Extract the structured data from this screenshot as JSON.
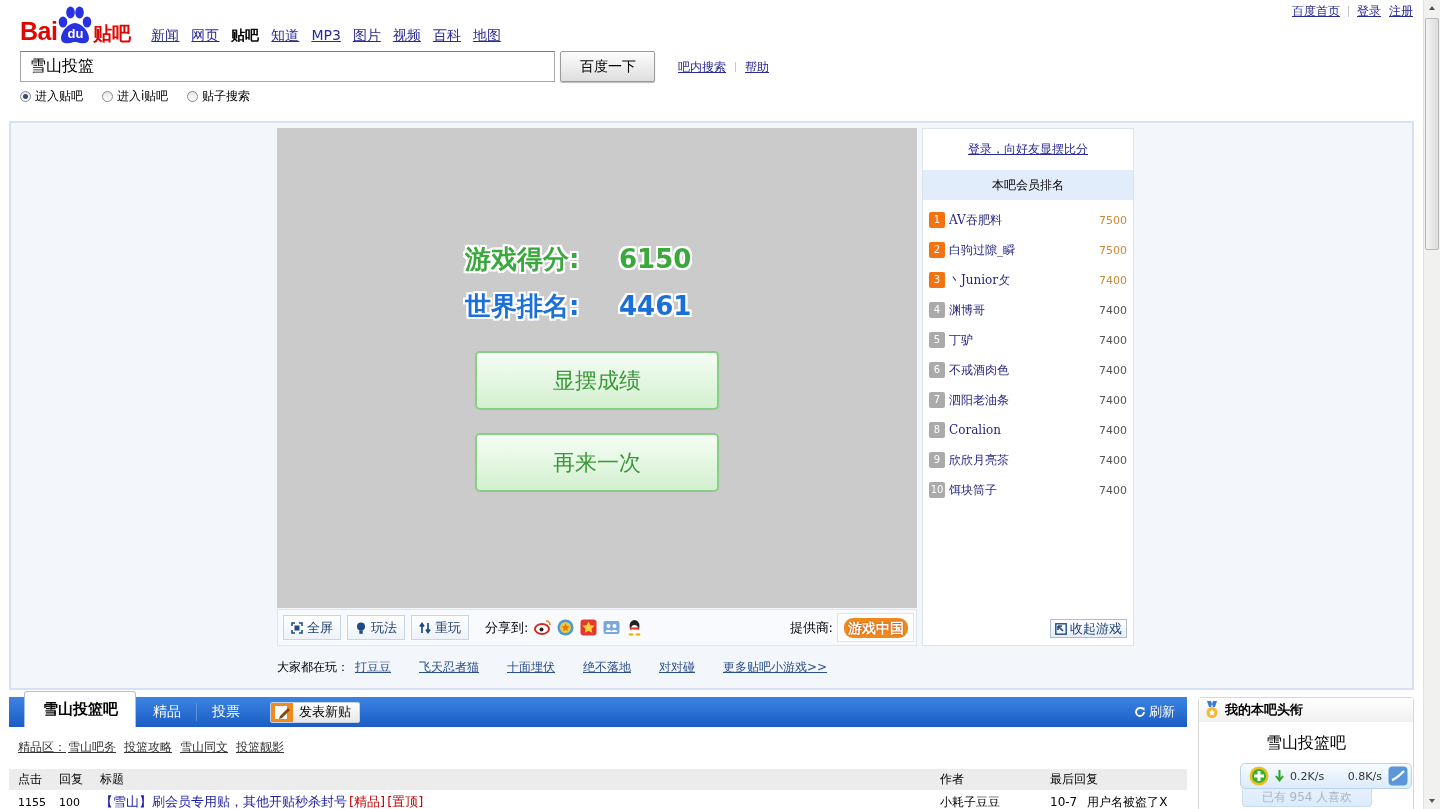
{
  "top_links": [
    {
      "label": "百度首页"
    },
    {
      "label": "登录"
    },
    {
      "label": "注册"
    }
  ],
  "logo": {
    "left": "Bai",
    "paw": "du",
    "right": "贴吧"
  },
  "nav": [
    {
      "label": "新闻",
      "selected": false
    },
    {
      "label": "网页",
      "selected": false
    },
    {
      "label": "贴吧",
      "selected": true
    },
    {
      "label": "知道",
      "selected": false
    },
    {
      "label": "MP3",
      "selected": false
    },
    {
      "label": "图片",
      "selected": false
    },
    {
      "label": "视频",
      "selected": false
    },
    {
      "label": "百科",
      "selected": false
    },
    {
      "label": "地图",
      "selected": false
    }
  ],
  "search": {
    "value": "雪山投篮",
    "button": "百度一下",
    "links": [
      {
        "label": "吧内搜索"
      },
      {
        "label": "帮助"
      }
    ]
  },
  "search_modes": [
    {
      "label": "进入贴吧",
      "selected": true
    },
    {
      "label": "进入i贴吧",
      "selected": false
    },
    {
      "label": "贴子搜索",
      "selected": false
    }
  ],
  "game": {
    "stats": [
      {
        "kind": "score",
        "label": "游戏得分:",
        "value": "6150"
      },
      {
        "kind": "rank",
        "label": "世界排名:",
        "value": "4461"
      }
    ],
    "buttons": [
      {
        "label": "显摆成绩"
      },
      {
        "label": "再来一次"
      }
    ],
    "toolbar": {
      "buttons": [
        {
          "label": "全屏"
        },
        {
          "label": "玩法"
        },
        {
          "label": "重玩"
        }
      ],
      "share_label": "分享到:",
      "provider_label": "提供商:",
      "provider_logo": "游戏中国"
    }
  },
  "leaderboard": {
    "login_link": "登录，向好友显摆比分",
    "title": "本吧会员排名",
    "rows": [
      {
        "rank": "1",
        "name": "AV吞肥料",
        "score": "7500",
        "highlighted": true
      },
      {
        "rank": "2",
        "name": "白驹过隙_瞬",
        "score": "7500",
        "highlighted": true
      },
      {
        "rank": "3",
        "name": "丶Junior攵",
        "score": "7400",
        "highlighted": true
      },
      {
        "rank": "4",
        "name": "渊博哥",
        "score": "7400",
        "highlighted": false
      },
      {
        "rank": "5",
        "name": "丁驴",
        "score": "7400",
        "highlighted": false
      },
      {
        "rank": "6",
        "name": "不戒酒肉色",
        "score": "7400",
        "highlighted": false
      },
      {
        "rank": "7",
        "name": "泗阳老油条",
        "score": "7400",
        "highlighted": false
      },
      {
        "rank": "8",
        "name": "Coralion",
        "score": "7400",
        "highlighted": false
      },
      {
        "rank": "9",
        "name": "欣欣月亮茶",
        "score": "7400",
        "highlighted": false
      },
      {
        "rank": "10",
        "name": "饵块筒子",
        "score": "7400",
        "highlighted": false
      }
    ],
    "collapse_button": "收起游戏"
  },
  "popular_games": {
    "label": "大家都在玩：",
    "links": [
      {
        "label": "打豆豆"
      },
      {
        "label": "飞天忍者猫"
      },
      {
        "label": "十面埋伏"
      },
      {
        "label": "绝不落地"
      },
      {
        "label": "对对碰"
      },
      {
        "label": "更多贴吧小游戏>>"
      }
    ]
  },
  "forum": {
    "tabs": [
      {
        "label": "雪山投篮吧",
        "selected": true
      },
      {
        "label": "精品",
        "selected": false
      },
      {
        "label": "投票",
        "selected": false
      }
    ],
    "post_button": "发表新贴",
    "refresh": "刷新",
    "featured": {
      "label": "精品区：",
      "links": [
        {
          "label": "雪山吧务"
        },
        {
          "label": "投篮攻略"
        },
        {
          "label": "雪山同文"
        },
        {
          "label": "投篮靓影"
        }
      ]
    },
    "table": {
      "columns": [
        "点击",
        "回复",
        "标题",
        "作者",
        "最后回复"
      ],
      "rows": [
        {
          "clicks": "1155",
          "replies": "100",
          "title": "【雪山】刷会员专用贴，其他开贴秒杀封号",
          "tags": [
            "[精品]",
            "[置顶]"
          ],
          "author": "小耗子豆豆",
          "last_reply_date": "10-7",
          "last_reply_user": "用户名被盗了X"
        }
      ]
    }
  },
  "sidebar": {
    "title": "我的本吧头衔",
    "forum_name": "雪山投篮吧",
    "likes": "已有 954 人喜欢"
  },
  "speed_widget": {
    "download": "0.2K/s",
    "upload": "0.8K/s"
  }
}
